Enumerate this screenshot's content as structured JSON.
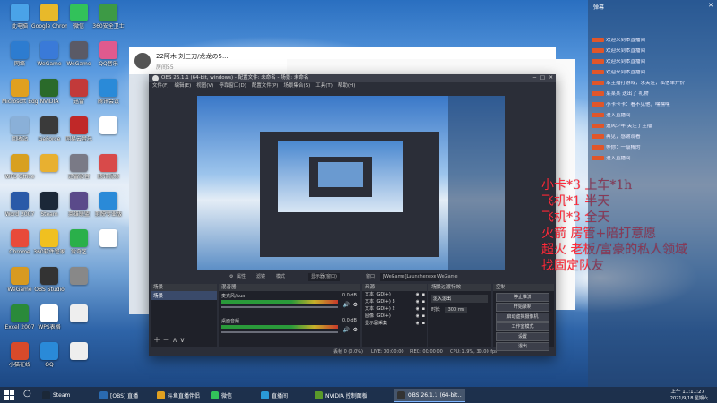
{
  "desktop": {
    "icons": [
      {
        "label": "此电脑",
        "color": "#4aa3e8",
        "col": 0,
        "row": 0
      },
      {
        "label": "Google Chrome",
        "color": "#e8b92a",
        "col": 1,
        "row": 0
      },
      {
        "label": "微信",
        "color": "#32c25a",
        "col": 2,
        "row": 0
      },
      {
        "label": "360安全卫士",
        "color": "#3d9a45",
        "col": 3,
        "row": 0
      },
      {
        "label": "网络",
        "color": "#2d7cd0",
        "col": 0,
        "row": 1
      },
      {
        "label": "WeGame",
        "color": "#3a7ad8",
        "col": 1,
        "row": 1
      },
      {
        "label": "WeGame",
        "color": "#5a5a66",
        "col": 2,
        "row": 1
      },
      {
        "label": "QQ音乐",
        "color": "#e05a8e",
        "col": 3,
        "row": 1
      },
      {
        "label": "Microsoft Edge",
        "color": "#e0a020",
        "col": 0,
        "row": 2
      },
      {
        "label": "NVIDIA",
        "color": "#2a6a2a",
        "col": 1,
        "row": 2
      },
      {
        "label": "迅雷",
        "color": "#c23a3a",
        "col": 2,
        "row": 2
      },
      {
        "label": "腾讯会议",
        "color": "#2a8ad8",
        "col": 3,
        "row": 2
      },
      {
        "label": "回收站",
        "color": "#8ab0d8",
        "col": 0,
        "row": 3
      },
      {
        "label": "GeForce",
        "color": "#3a3a3a",
        "col": 1,
        "row": 3
      },
      {
        "label": "网易云音乐",
        "color": "#c02828",
        "col": 2,
        "row": 3
      },
      {
        "label": "",
        "color": "#ffffff",
        "col": 3,
        "row": 3
      },
      {
        "label": "WPS Office",
        "color": "#d8a020",
        "col": 0,
        "row": 4
      },
      {
        "label": "",
        "color": "#e8b030",
        "col": 1,
        "row": 4
      },
      {
        "label": "迅雷影音",
        "color": "#7a7a86",
        "col": 2,
        "row": 4
      },
      {
        "label": "腾讯视频",
        "color": "#d84a4a",
        "col": 3,
        "row": 4
      },
      {
        "label": "Word 2007",
        "color": "#2a5aa8",
        "col": 0,
        "row": 5
      },
      {
        "label": "Steam",
        "color": "#1b2838",
        "col": 1,
        "row": 5
      },
      {
        "label": "英雄联盟",
        "color": "#5a4a8a",
        "col": 2,
        "row": 5
      },
      {
        "label": "剪映专业版",
        "color": "#2a8ad8",
        "col": 3,
        "row": 5
      },
      {
        "label": "Chrome",
        "color": "#e84a3a",
        "col": 0,
        "row": 6
      },
      {
        "label": "360软件管家",
        "color": "#f0c020",
        "col": 1,
        "row": 6
      },
      {
        "label": "爱奇艺",
        "color": "#2ab04a",
        "col": 2,
        "row": 6
      },
      {
        "label": "",
        "color": "#ffffff",
        "col": 3,
        "row": 6
      },
      {
        "label": "WeGame",
        "color": "#d89a20",
        "col": 0,
        "row": 7
      },
      {
        "label": "OBS Studio",
        "color": "#333333",
        "col": 1,
        "row": 7
      },
      {
        "label": "",
        "color": "#888888",
        "col": 2,
        "row": 7
      },
      {
        "label": "Excel 2007",
        "color": "#2a8a3a",
        "col": 0,
        "row": 8
      },
      {
        "label": "WPS表格",
        "color": "#ffffff",
        "col": 1,
        "row": 8
      },
      {
        "label": "",
        "color": "#eeeeee",
        "col": 2,
        "row": 8
      },
      {
        "label": "小猫在线",
        "color": "#d84a2a",
        "col": 0,
        "row": 9
      },
      {
        "label": "QQ",
        "color": "#2a8ad8",
        "col": 1,
        "row": 9
      },
      {
        "label": "",
        "color": "#eeeeee",
        "col": 2,
        "row": 9
      }
    ]
  },
  "back_window": {
    "title": "22阿木  刘三刀/龙龙の5...",
    "subtitle": "房间55"
  },
  "obs": {
    "title": "OBS 26.1.1 (64-bit, windows) - 配置文件: 未命名 - 场景: 未命名",
    "menu": [
      "文件(F)",
      "编辑(E)",
      "视图(V)",
      "停靠窗口(D)",
      "配置文件(P)",
      "场景集合(S)",
      "工具(T)",
      "帮助(H)"
    ],
    "toolbar": {
      "props": "属性",
      "filter": "滤镜",
      "mode": "模式",
      "display": "显示器(窗口)",
      "capture": "窗口",
      "window_target": "[WeGame]Launcher.exe",
      "sub": "WeGame"
    },
    "panels": {
      "scenes": "场景",
      "sources": "来源",
      "mixer": "混音器",
      "transitions": "场景过渡特效",
      "controls": "控制"
    },
    "scene_item": "场景",
    "mixer_tracks": [
      {
        "name": "麦克风/Aux",
        "db": "0.0 dB"
      },
      {
        "name": "桌面音频",
        "db": "0.0 dB"
      }
    ],
    "sources": [
      "文本 (GDI+)",
      "文本 (GDI+) 3",
      "文本 (GDI+) 2",
      "图像 (GDI+)",
      "显示器采集"
    ],
    "transition": {
      "name": "淡入淡出",
      "duration_label": "时长",
      "duration": "300 ms"
    },
    "controls": [
      "停止推流",
      "开始录制",
      "启动虚拟摄像机",
      "工作室模式",
      "设置",
      "退出"
    ],
    "status": {
      "live": "LIVE: 00:00:00",
      "rec": "REC: 00:00:00",
      "cpu": "CPU: 1.9%, 30.00 fps",
      "drop": "丢帧 0 (0.0%)"
    }
  },
  "overlay_lines": [
    "小卡*3 上车*1h",
    "飞机*1 半天",
    "飞机*3 全天",
    "火箭 房管+陪打意愿",
    "超火 老板/富豪的私人领域",
    "找固定队友"
  ],
  "chat": {
    "header": "弹幕",
    "rows": [
      "欢迎来到本直播间",
      "欢迎来到本直播间",
      "欢迎来到本直播间",
      "欢迎来到本直播间",
      "本主播打游戏，求关注，私信单开价",
      "某某某 送出了 礼物",
      "小卡卡卡：看不见他，嘿嘿嘿",
      "进入直播间",
      "追风少年 关注了主播",
      "再见，感谢观看",
      "等你：一级棒的",
      "进入直播间"
    ]
  },
  "taskbar": {
    "items": [
      {
        "label": "Steam",
        "color": "#1b2838",
        "active": false
      },
      {
        "label": "[OBS] 直播",
        "color": "#2a6ab0",
        "active": false
      },
      {
        "label": "斗鱼直播伴侣",
        "color": "#e0a020",
        "active": false
      },
      {
        "label": "微信",
        "color": "#32c25a",
        "active": false
      },
      {
        "label": "直播间",
        "color": "#2a9ad8",
        "active": false
      },
      {
        "label": "NVIDIA 控制面板",
        "color": "#5a9a2a",
        "active": false
      },
      {
        "label": "OBS 26.1.1 (64-bit...",
        "color": "#333333",
        "active": true
      }
    ],
    "time": "上午 11:11:27",
    "date": "2021/9/18 星期六"
  }
}
